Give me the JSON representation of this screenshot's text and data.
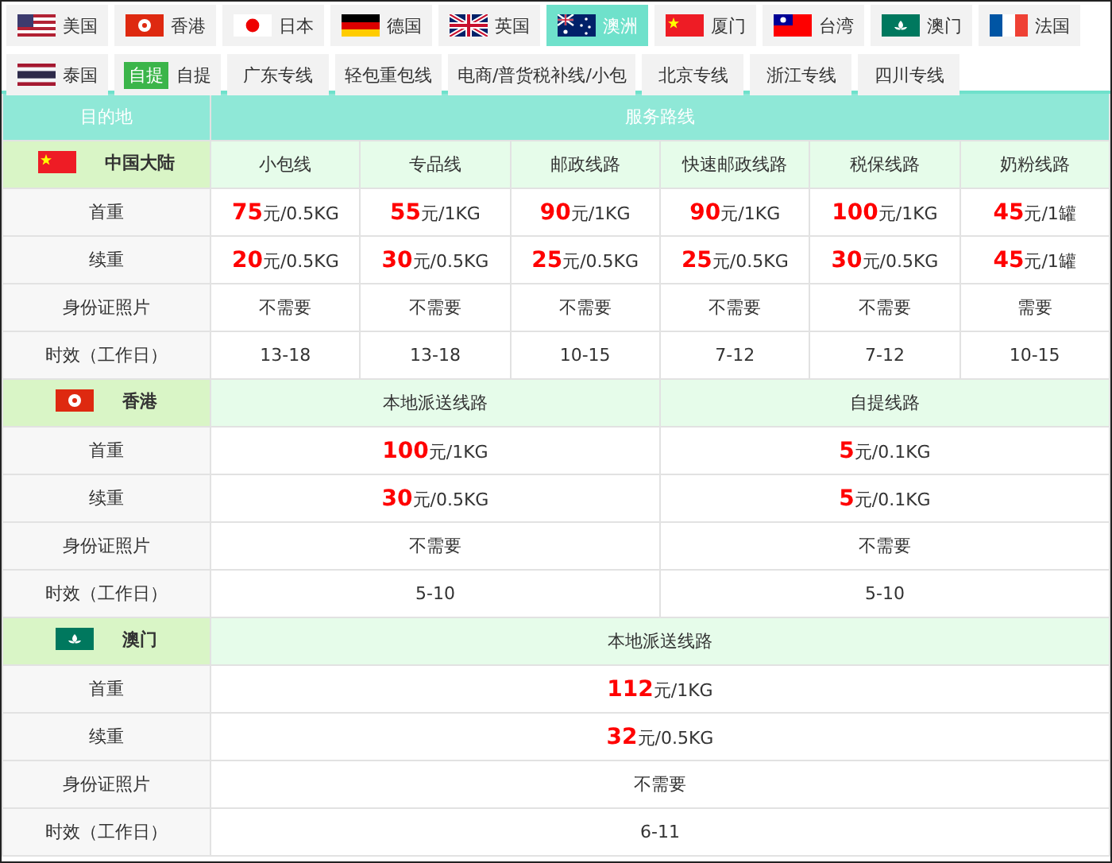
{
  "tabs": [
    {
      "label": "美国",
      "kind": "us",
      "selected": false
    },
    {
      "label": "香港",
      "kind": "hk",
      "selected": false
    },
    {
      "label": "日本",
      "kind": "jp",
      "selected": false
    },
    {
      "label": "德国",
      "kind": "de",
      "selected": false
    },
    {
      "label": "英国",
      "kind": "uk",
      "selected": false
    },
    {
      "label": "澳洲",
      "kind": "au",
      "selected": true
    },
    {
      "label": "厦门",
      "kind": "cn",
      "selected": false
    },
    {
      "label": "台湾",
      "kind": "tw",
      "selected": false
    },
    {
      "label": "澳门",
      "kind": "mo",
      "selected": false
    },
    {
      "label": "法国",
      "kind": "fr",
      "selected": false
    },
    {
      "label": "泰国",
      "kind": "th",
      "selected": false
    },
    {
      "label": "自提",
      "kind": "badge",
      "badge": "自提",
      "selected": false
    },
    {
      "label": "广东专线",
      "kind": "plain",
      "selected": false
    },
    {
      "label": "轻包重包线",
      "kind": "plain",
      "selected": false
    },
    {
      "label": "电商/普货税补线/小包",
      "kind": "plain",
      "selected": false
    },
    {
      "label": "北京专线",
      "kind": "plain",
      "selected": false
    },
    {
      "label": "浙江专线",
      "kind": "plain",
      "selected": false
    },
    {
      "label": "四川专线",
      "kind": "plain",
      "selected": false
    }
  ],
  "table": {
    "columns": [
      "目的地",
      "服务路线"
    ],
    "sections": [
      {
        "region": "中国大陆",
        "kind": "cn",
        "routes": [
          "小包线",
          "专品线",
          "邮政线路",
          "快速邮政线路",
          "税保线路",
          "奶粉线路"
        ],
        "rows": [
          {
            "label": "首重",
            "kind": "price",
            "cells": [
              {
                "amount": "75",
                "unit": "元/0.5KG"
              },
              {
                "amount": "55",
                "unit": "元/1KG"
              },
              {
                "amount": "90",
                "unit": "元/1KG"
              },
              {
                "amount": "90",
                "unit": "元/1KG"
              },
              {
                "amount": "100",
                "unit": "元/1KG"
              },
              {
                "amount": "45",
                "unit": "元/1罐"
              }
            ]
          },
          {
            "label": "续重",
            "kind": "price",
            "cells": [
              {
                "amount": "20",
                "unit": "元/0.5KG"
              },
              {
                "amount": "30",
                "unit": "元/0.5KG"
              },
              {
                "amount": "25",
                "unit": "元/0.5KG"
              },
              {
                "amount": "25",
                "unit": "元/0.5KG"
              },
              {
                "amount": "30",
                "unit": "元/0.5KG"
              },
              {
                "amount": "45",
                "unit": "元/1罐"
              }
            ]
          },
          {
            "label": "身份证照片",
            "kind": "text",
            "cells": [
              "不需要",
              "不需要",
              "不需要",
              "不需要",
              "不需要",
              "需要"
            ]
          },
          {
            "label": "时效（工作日）",
            "kind": "text",
            "cells": [
              "13-18",
              "13-18",
              "10-15",
              "7-12",
              "7-12",
              "10-15"
            ]
          }
        ]
      },
      {
        "region": "香港",
        "kind": "hk",
        "routes": [
          "本地派送线路",
          "自提线路"
        ],
        "rows": [
          {
            "label": "首重",
            "kind": "price",
            "cells": [
              {
                "amount": "100",
                "unit": "元/1KG"
              },
              {
                "amount": "5",
                "unit": "元/0.1KG"
              }
            ]
          },
          {
            "label": "续重",
            "kind": "price",
            "cells": [
              {
                "amount": "30",
                "unit": "元/0.5KG"
              },
              {
                "amount": "5",
                "unit": "元/0.1KG"
              }
            ]
          },
          {
            "label": "身份证照片",
            "kind": "text",
            "cells": [
              "不需要",
              "不需要"
            ]
          },
          {
            "label": "时效（工作日）",
            "kind": "text",
            "cells": [
              "5-10",
              "5-10"
            ]
          }
        ]
      },
      {
        "region": "澳门",
        "kind": "mo",
        "routes": [
          "本地派送线路"
        ],
        "rows": [
          {
            "label": "首重",
            "kind": "price",
            "cells": [
              {
                "amount": "112",
                "unit": "元/1KG"
              }
            ]
          },
          {
            "label": "续重",
            "kind": "price",
            "cells": [
              {
                "amount": "32",
                "unit": "元/0.5KG"
              }
            ]
          },
          {
            "label": "身份证照片",
            "kind": "text",
            "cells": [
              "不需要"
            ]
          },
          {
            "label": "时效（工作日）",
            "kind": "text",
            "cells": [
              "6-11"
            ]
          }
        ]
      }
    ]
  }
}
